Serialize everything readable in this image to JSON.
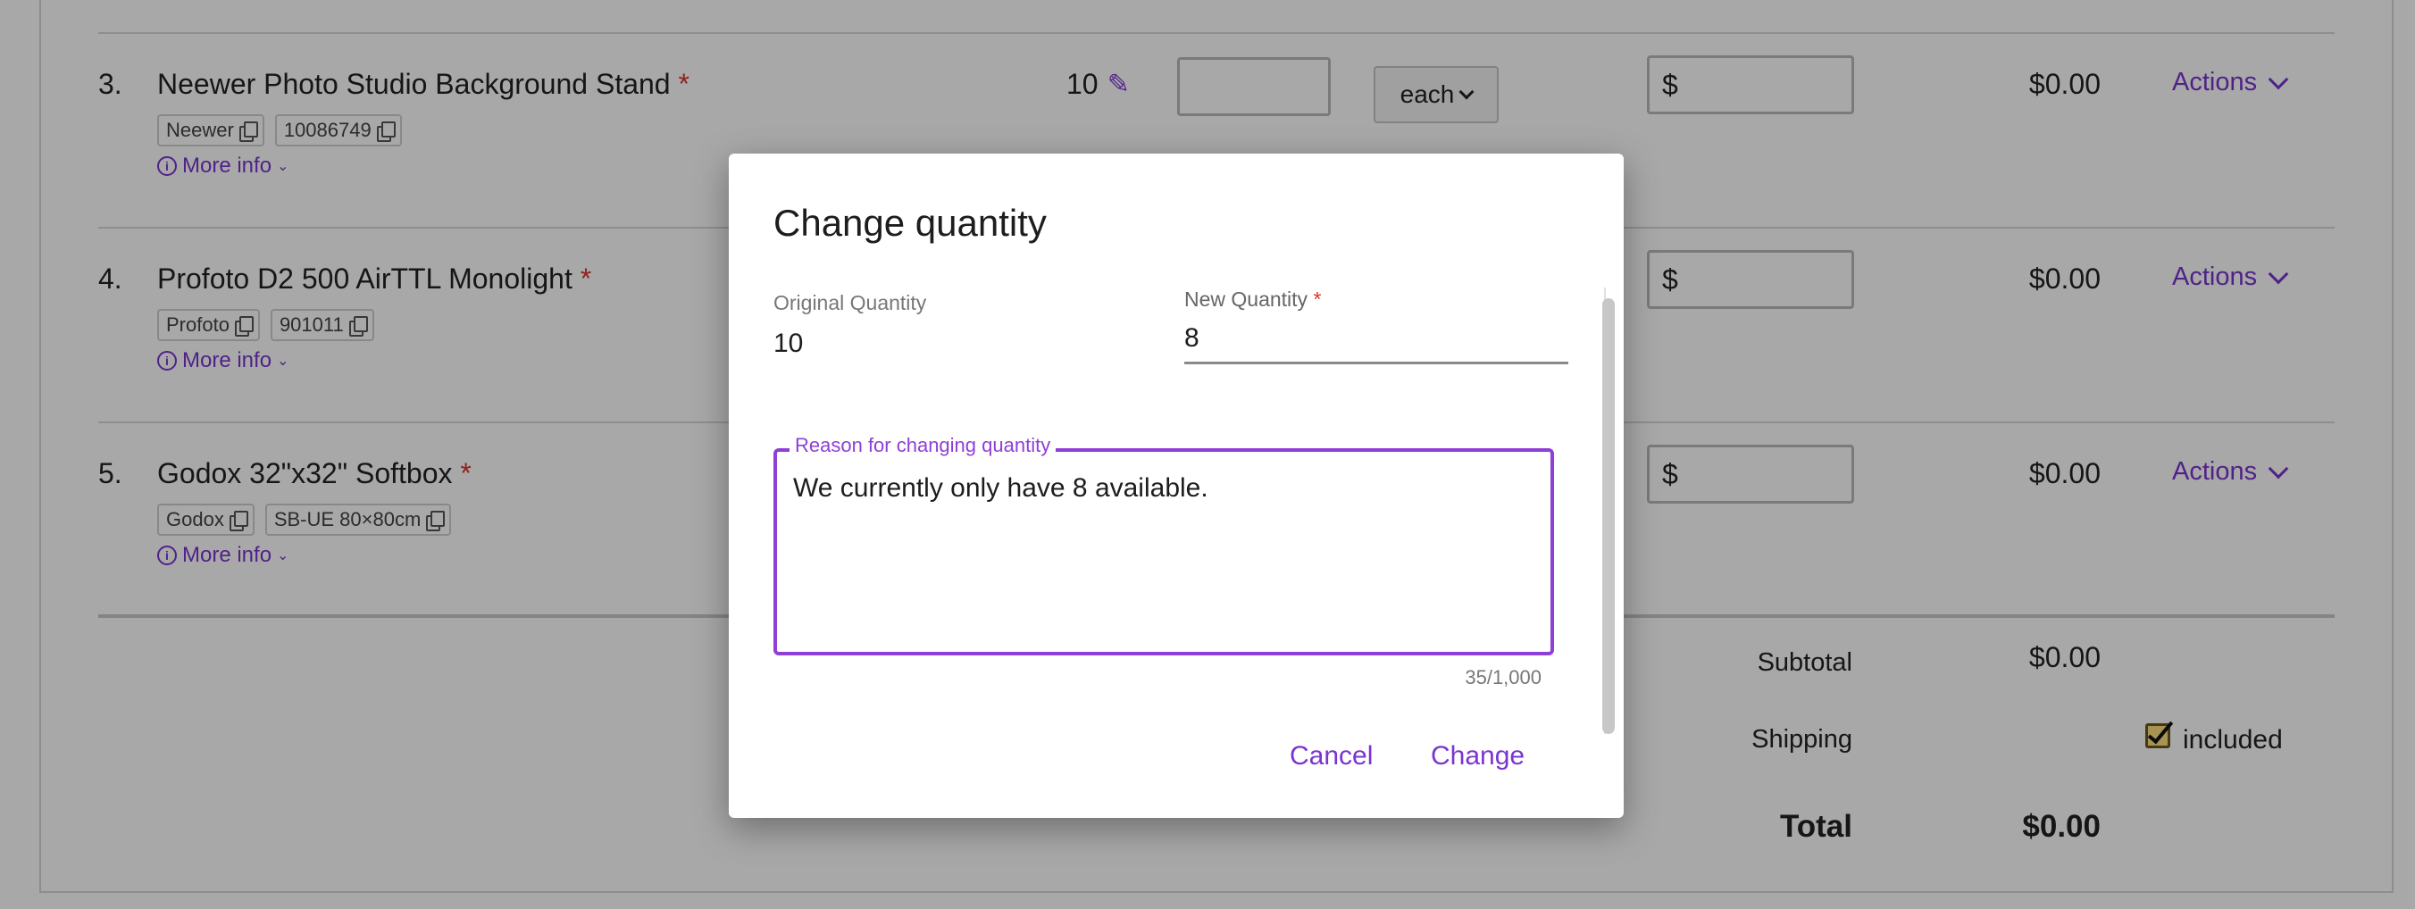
{
  "items": [
    {
      "num": "3.",
      "name": "Neewer Photo Studio Background Stand",
      "brand": "Neewer",
      "sku": "10086749",
      "more_info": "More info",
      "qty": "10",
      "unit": "each",
      "currency": "$",
      "amount": "$0.00",
      "actions": "Actions"
    },
    {
      "num": "4.",
      "name": "Profoto D2 500 AirTTL Monolight",
      "brand": "Profoto",
      "sku": "901011",
      "more_info": "More info",
      "currency": "$",
      "amount": "$0.00",
      "actions": "Actions"
    },
    {
      "num": "5.",
      "name": "Godox 32\"x32\" Softbox",
      "brand": "Godox",
      "sku": "SB-UE 80×80cm",
      "more_info": "More info",
      "currency": "$",
      "amount": "$0.00",
      "actions": "Actions"
    }
  ],
  "required_mark": "*",
  "totals": {
    "subtotal_label": "Subtotal",
    "subtotal_value": "$0.00",
    "shipping_label": "Shipping",
    "shipping_included_label": "included",
    "shipping_included_checked": true,
    "total_label": "Total",
    "total_value": "$0.00"
  },
  "modal": {
    "title": "Change quantity",
    "original_label": "Original Quantity",
    "original_value": "10",
    "new_label": "New Quantity",
    "new_required": "*",
    "new_value": "8",
    "reason_label": "Reason for changing quantity",
    "reason_value": "We currently only have 8 available.",
    "counter": "35/1,000",
    "cancel": "Cancel",
    "change": "Change"
  },
  "icons": {
    "copy": "copy-icon",
    "info": "info-icon",
    "pencil": "pencil-icon",
    "chevron": "chevron-down-icon",
    "check": "checkbox-checked-icon"
  },
  "colors": {
    "accent": "#7a35d0",
    "required": "#d9352c",
    "overlay": "rgba(0,0,0,0.34)"
  }
}
